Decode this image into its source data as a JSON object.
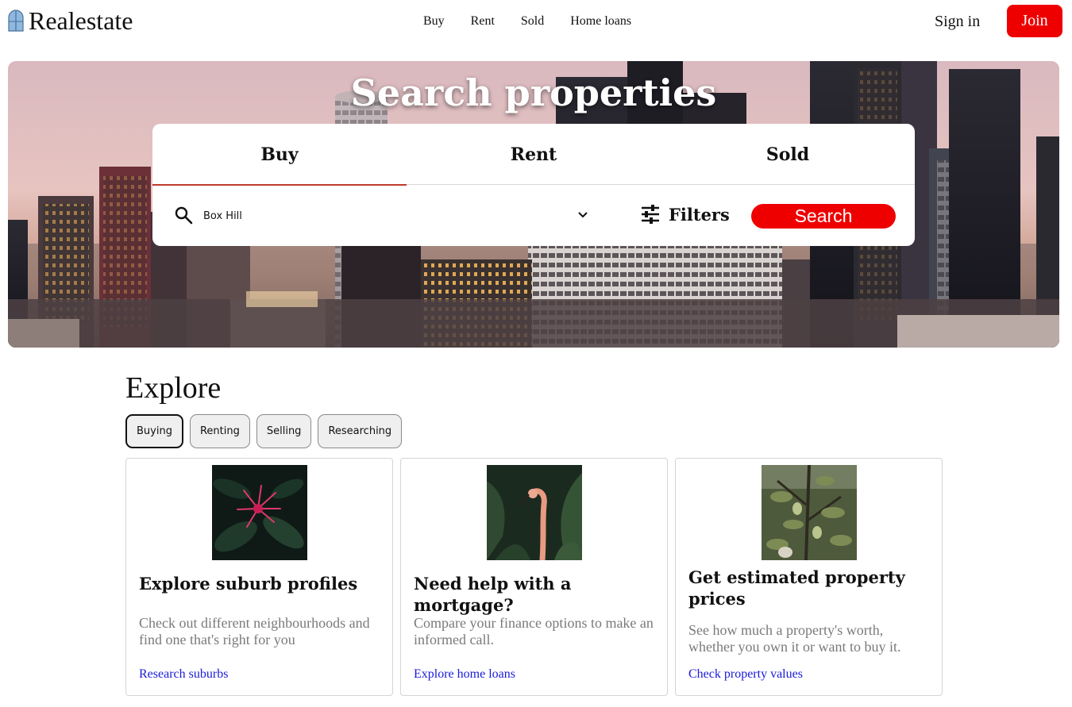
{
  "header": {
    "logo_text": "Realestate",
    "nav": [
      "Buy",
      "Rent",
      "Sold",
      "Home loans"
    ],
    "sign_in": "Sign in",
    "join": "Join"
  },
  "hero": {
    "title": "Search properties",
    "tabs": [
      {
        "label": "Buy",
        "active": true
      },
      {
        "label": "Rent",
        "active": false
      },
      {
        "label": "Sold",
        "active": false
      }
    ],
    "search": {
      "value": "Box Hill",
      "icon": "search-icon"
    },
    "filters_label": "Filters",
    "search_button": "Search"
  },
  "explore": {
    "title": "Explore",
    "chips": [
      {
        "label": "Buying",
        "active": true
      },
      {
        "label": "Renting",
        "active": false
      },
      {
        "label": "Selling",
        "active": false
      },
      {
        "label": "Researching",
        "active": false
      }
    ],
    "cards": [
      {
        "title": "Explore suburb profiles",
        "description": "Check out different neighbourhoods and find one that's right for you",
        "link": "Research suburbs"
      },
      {
        "title": "Need help with a mortgage?",
        "description": "Compare your finance options to make an informed call.",
        "link": "Explore home loans"
      },
      {
        "title": "Get estimated property prices",
        "description": "See how much a property's worth, whether you own it or want to buy it.",
        "link": "Check property values"
      }
    ]
  },
  "colors": {
    "accent": "#ee0000",
    "link": "#1a1adb",
    "tab_underline": "#c0392b"
  }
}
